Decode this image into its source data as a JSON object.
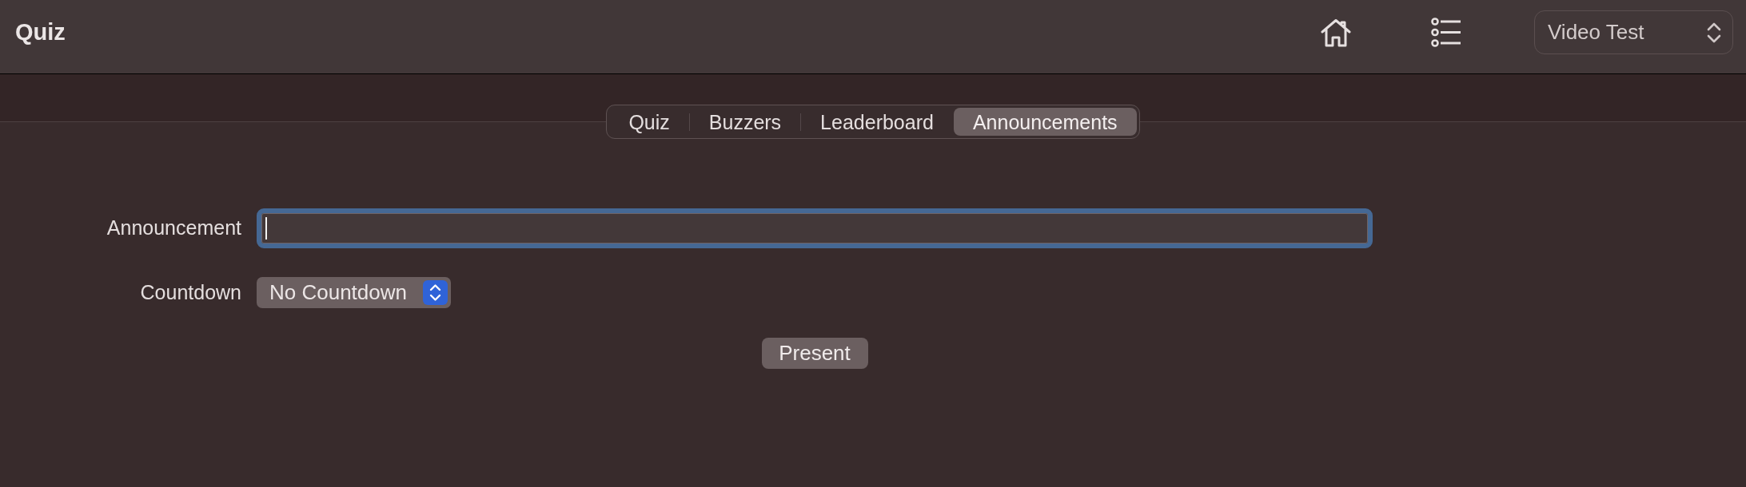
{
  "window": {
    "title": "Quiz"
  },
  "toolbar": {
    "project_selector": {
      "value": "Video Test"
    }
  },
  "tabs": [
    {
      "label": "Quiz",
      "selected": false
    },
    {
      "label": "Buzzers",
      "selected": false
    },
    {
      "label": "Leaderboard",
      "selected": false
    },
    {
      "label": "Announcements",
      "selected": true
    }
  ],
  "form": {
    "fields": [
      {
        "kind": "text",
        "label": "Announcement",
        "focused": true
      },
      {
        "kind": "popup",
        "label": "Countdown",
        "value": "No Countdown"
      }
    ],
    "buttons": [
      "Present"
    ]
  }
}
